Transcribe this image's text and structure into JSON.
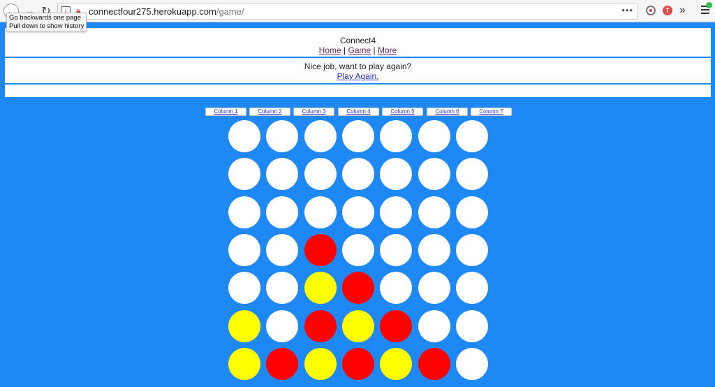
{
  "browser": {
    "url_domain": "connectfour275.herokuapp.com",
    "url_path": "/game/",
    "tooltip_line1": "Go backwards one page",
    "tooltip_line2": "Pull down to show history",
    "more_dots": "•••",
    "ext2_letter": "T"
  },
  "header": {
    "title": "Connect4",
    "nav": [
      "Home",
      "Game",
      "More"
    ]
  },
  "message": {
    "text": "Nice job, want to play again?",
    "link": "Play Again."
  },
  "columns": [
    "Column 1",
    "Column 2",
    "Column 3",
    "Column 4",
    "Column 5",
    "Column 6",
    "Column 7"
  ],
  "colors": {
    "page_bg": "#1e88f4",
    "empty": "#ffffff",
    "red": "#ff0000",
    "yellow": "#ffff00"
  },
  "board": [
    [
      "empty",
      "empty",
      "empty",
      "empty",
      "empty",
      "empty",
      "empty"
    ],
    [
      "empty",
      "empty",
      "empty",
      "empty",
      "empty",
      "empty",
      "empty"
    ],
    [
      "empty",
      "empty",
      "empty",
      "empty",
      "empty",
      "empty",
      "empty"
    ],
    [
      "empty",
      "empty",
      "red",
      "empty",
      "empty",
      "empty",
      "empty"
    ],
    [
      "empty",
      "empty",
      "yellow",
      "red",
      "empty",
      "empty",
      "empty"
    ],
    [
      "yellow",
      "empty",
      "red",
      "yellow",
      "red",
      "empty",
      "empty"
    ],
    [
      "yellow",
      "red",
      "yellow",
      "red",
      "yellow",
      "red",
      "empty"
    ]
  ]
}
